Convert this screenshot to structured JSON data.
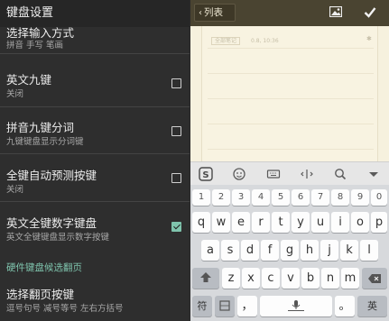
{
  "settings": {
    "title": "键盘设置",
    "items": [
      {
        "title": "选择输入方式",
        "subtitle": "拼音 手写 笔画"
      },
      {
        "title": "英文九键",
        "subtitle": "关闭",
        "checked": false
      },
      {
        "title": "拼音九键分词",
        "subtitle": "九键键盘显示分词键",
        "checked": false
      },
      {
        "title": "全键自动预测按键",
        "subtitle": "关闭",
        "checked": false
      },
      {
        "title": "英文全键数字键盘",
        "subtitle": "英文全键键盘显示数字按键",
        "checked": true
      }
    ],
    "section_title": "硬件键盘候选翻页",
    "page_item": {
      "title": "选择翻页按键",
      "subtitle": "逗号句号 减号等号 左右方括号"
    }
  },
  "editor": {
    "back_label": "列表",
    "meta_tag": "全部笔记",
    "meta_time": "0.8, 10:36",
    "colors": {
      "topbar": "#4a4431",
      "paper": "#f6f1de",
      "accent": "#7fc4ad"
    }
  },
  "keyboard": {
    "toolbar_icons": [
      "sogou-logo-icon",
      "emoji-icon",
      "keyboard-icon",
      "cursor-move-icon",
      "search-icon",
      "hide-keyboard-icon"
    ],
    "row_numbers": [
      "1",
      "2",
      "3",
      "4",
      "5",
      "6",
      "7",
      "8",
      "9",
      "0"
    ],
    "row1": [
      "q",
      "w",
      "e",
      "r",
      "t",
      "y",
      "u",
      "i",
      "o",
      "p"
    ],
    "row2": [
      "a",
      "s",
      "d",
      "f",
      "g",
      "h",
      "j",
      "k",
      "l"
    ],
    "row3": [
      "z",
      "x",
      "c",
      "v",
      "b",
      "n",
      "m"
    ],
    "bottom": {
      "symbols": "符",
      "comma": "，",
      "period": "。",
      "en_cn": "英"
    }
  }
}
